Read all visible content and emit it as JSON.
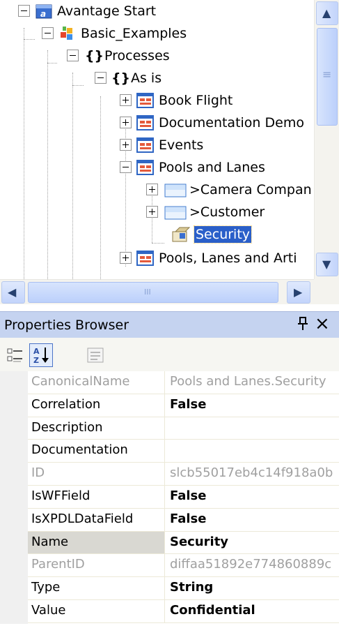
{
  "tree": {
    "root": "Avantage Start",
    "project": "Basic_Examples",
    "processes": "Processes",
    "as_is": "As is",
    "items": {
      "book_flight": "Book Flight",
      "documentation_demo": "Documentation Demo",
      "events": "Events",
      "pools_and_lanes": "Pools and Lanes",
      "camera_company": ">Camera Compan",
      "customer": ">Customer",
      "security": "Security",
      "pools_lanes_arti": "Pools, Lanes  and Arti"
    },
    "braces_glyph": "{}"
  },
  "scrollbar": {
    "up": "▲",
    "down": "▼",
    "left": "◀",
    "right": "▶",
    "grip": "≡",
    "hgrip": "III"
  },
  "properties": {
    "title": "Properties Browser",
    "pin_glyph": "ᵖ",
    "close_glyph": "×",
    "rows": [
      {
        "name": "CanonicalName",
        "value": "Pools and Lanes.Security",
        "readonly": true,
        "bold": false
      },
      {
        "name": "Correlation",
        "value": "False",
        "readonly": false,
        "bold": true
      },
      {
        "name": "Description",
        "value": "",
        "readonly": false,
        "bold": false
      },
      {
        "name": "Documentation",
        "value": "",
        "readonly": false,
        "bold": false
      },
      {
        "name": "ID",
        "value": "slcb55017eb4c14f918a0b",
        "readonly": true,
        "bold": false
      },
      {
        "name": "IsWFField",
        "value": "False",
        "readonly": false,
        "bold": true
      },
      {
        "name": "IsXPDLDataField",
        "value": "False",
        "readonly": false,
        "bold": true
      },
      {
        "name": "Name",
        "value": "Security",
        "readonly": false,
        "bold": true
      },
      {
        "name": "ParentID",
        "value": "diffaa51892e774860889c",
        "readonly": true,
        "bold": false
      },
      {
        "name": "Type",
        "value": "String",
        "readonly": false,
        "bold": true
      },
      {
        "name": "Value",
        "value": "Confidential",
        "readonly": false,
        "bold": true
      }
    ],
    "selected_row": "Name"
  },
  "colors": {
    "selection": "#2a5fc9",
    "header": "#c5d3f0",
    "readonly_text": "#a0a0a0"
  }
}
